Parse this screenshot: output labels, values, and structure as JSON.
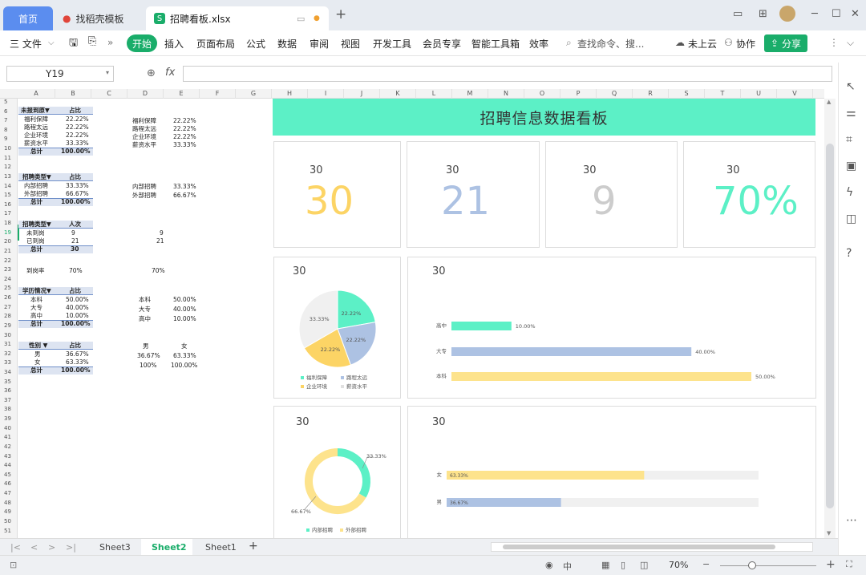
{
  "tabs": {
    "home": "首页",
    "template": "找稻壳模板",
    "file": "招聘看板.xlsx"
  },
  "ribbon": {
    "file": "三 文件",
    "start": "开始",
    "items": [
      "插入",
      "页面布局",
      "公式",
      "数据",
      "审阅",
      "视图",
      "开发工具",
      "会员专享",
      "智能工具箱",
      "效率"
    ],
    "search": "查找命令、搜...",
    "cloud": "未上云",
    "collab": "协作",
    "share": "分享"
  },
  "namebox": "Y19",
  "fx": "fx",
  "columns": [
    "A",
    "B",
    "C",
    "D",
    "E",
    "F",
    "G",
    "H",
    "I",
    "J",
    "K",
    "L",
    "M",
    "N",
    "O",
    "P",
    "Q",
    "R",
    "S",
    "T",
    "U",
    "V"
  ],
  "rows": [
    "5",
    "6",
    "7",
    "8",
    "9",
    "10",
    "11",
    "12",
    "13",
    "14",
    "15",
    "16",
    "17",
    "18",
    "19",
    "20",
    "21",
    "22",
    "23",
    "24",
    "25",
    "26",
    "27",
    "28",
    "29",
    "30",
    "31",
    "32",
    "33",
    "34",
    "35",
    "36",
    "37",
    "38",
    "39",
    "40",
    "41",
    "42",
    "43",
    "44",
    "45",
    "46",
    "47",
    "48",
    "49",
    "50",
    "51"
  ],
  "table1": {
    "h1": "未报到原▼",
    "h2": "占比",
    "rows": [
      [
        "福利保障",
        "22.22%"
      ],
      [
        "路程太远",
        "22.22%"
      ],
      [
        "企业环境",
        "22.22%"
      ],
      [
        "薪资水平",
        "33.33%"
      ]
    ],
    "total": [
      "总计",
      "100.00%"
    ]
  },
  "copy1": [
    [
      "福利保障",
      "22.22%"
    ],
    [
      "路程太远",
      "22.22%"
    ],
    [
      "企业环境",
      "22.22%"
    ],
    [
      "薪资水平",
      "33.33%"
    ]
  ],
  "table2": {
    "h1": "招聘类型▼",
    "h2": "占比",
    "rows": [
      [
        "内部招聘",
        "33.33%"
      ],
      [
        "外部招聘",
        "66.67%"
      ]
    ],
    "total": [
      "总计",
      "100.00%"
    ]
  },
  "copy2": [
    [
      "内部招聘",
      "33.33%"
    ],
    [
      "外部招聘",
      "66.67%"
    ]
  ],
  "table3": {
    "h1": "招聘类型▼",
    "h2": "人次",
    "rows": [
      [
        "未到岗",
        "9"
      ],
      [
        "已到岗",
        "21"
      ]
    ],
    "total": [
      "总计",
      "30"
    ]
  },
  "copy3": [
    "9",
    "21"
  ],
  "rate": {
    "label": "到岗率",
    "value": "70%",
    "copy": "70%"
  },
  "table4": {
    "h1": "学历情况▼",
    "h2": "占比",
    "rows": [
      [
        "本科",
        "50.00%"
      ],
      [
        "大专",
        "40.00%"
      ],
      [
        "高中",
        "10.00%"
      ]
    ],
    "total": [
      "总计",
      "100.00%"
    ]
  },
  "copy4": [
    [
      "本科",
      "50.00%"
    ],
    [
      "大专",
      "40.00%"
    ],
    [
      "高中",
      "10.00%"
    ]
  ],
  "table5": {
    "h1": "性别 ▼",
    "h2": "占比",
    "rows": [
      [
        "男",
        "36.67%"
      ],
      [
        "女",
        "63.33%"
      ]
    ],
    "total": [
      "总计",
      "100.00%"
    ]
  },
  "copy5": {
    "h": [
      "男",
      "女"
    ],
    "r1": [
      "36.67%",
      "63.33%"
    ],
    "r2": [
      "100%",
      "100.00%"
    ]
  },
  "dashboard": {
    "title": "招聘信息数据看板",
    "kpis": [
      {
        "label": "30",
        "value": "30",
        "color": "#fcd465"
      },
      {
        "label": "30",
        "value": "21",
        "color": "#adc2e3"
      },
      {
        "label": "30",
        "value": "9",
        "color": "#cccccc"
      },
      {
        "label": "30",
        "value": "70%",
        "color": "#5cf0c6"
      }
    ],
    "pie_title": "30",
    "bar_title": "30",
    "donut_title": "30",
    "gender_title": "30"
  },
  "chart_data": [
    {
      "type": "pie",
      "categories": [
        "福利保障",
        "路程太远",
        "企业环境",
        "薪资水平"
      ],
      "values": [
        22.22,
        22.22,
        22.22,
        33.33
      ],
      "labels": [
        "22.22%",
        "22.22%",
        "22.22%",
        "33.33%"
      ],
      "colors": [
        "#5cf0c6",
        "#adc2e3",
        "#fcd465",
        "#f0f0f0"
      ],
      "legend": "bottom"
    },
    {
      "type": "bar",
      "categories": [
        "高中",
        "大专",
        "本科"
      ],
      "values": [
        10,
        40,
        50
      ],
      "labels": [
        "10.00%",
        "40.00%",
        "50.00%"
      ],
      "colors": [
        "#5cf0c6",
        "#adc2e3",
        "#fde38c"
      ],
      "xlim": [
        0,
        50
      ]
    },
    {
      "type": "pie",
      "categories": [
        "内部招聘",
        "外部招聘"
      ],
      "values": [
        33.33,
        66.67
      ],
      "labels": [
        "33.33%",
        "66.67%"
      ],
      "colors": [
        "#5cf0c6",
        "#fde38c"
      ],
      "legend": "bottom"
    },
    {
      "type": "bar",
      "categories": [
        "女",
        "男"
      ],
      "values": [
        63.33,
        36.67
      ],
      "labels": [
        "63.33%",
        "36.67%"
      ],
      "colors": [
        "#fde38c",
        "#adc2e3"
      ],
      "xlim": [
        0,
        100
      ]
    }
  ],
  "sheets": [
    "Sheet3",
    "Sheet2",
    "Sheet1"
  ],
  "status": {
    "zoom": "70%"
  }
}
